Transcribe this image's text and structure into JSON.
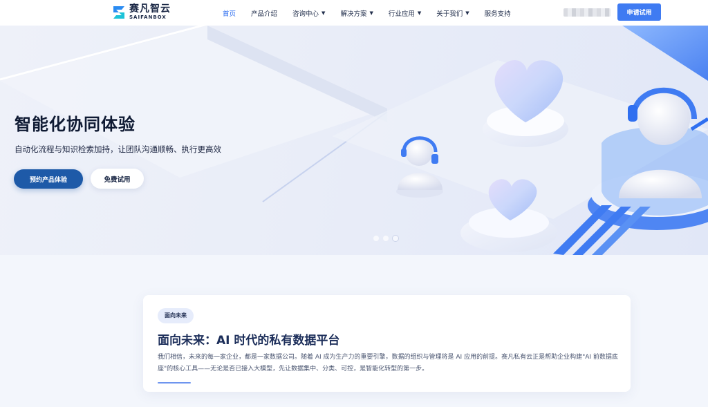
{
  "brand": {
    "name_cn": "赛凡智云",
    "name_en": "SAIFANBOX",
    "accent": "#3f7bf2"
  },
  "nav": {
    "items": [
      {
        "label": "首页",
        "active": true,
        "dropdown": false
      },
      {
        "label": "产品介绍",
        "active": false,
        "dropdown": false
      },
      {
        "label": "咨询中心",
        "active": false,
        "dropdown": true
      },
      {
        "label": "解决方案",
        "active": false,
        "dropdown": true
      },
      {
        "label": "行业应用",
        "active": false,
        "dropdown": true
      },
      {
        "label": "关于我们",
        "active": false,
        "dropdown": true
      },
      {
        "label": "服务支持",
        "active": false,
        "dropdown": false
      }
    ],
    "caret_glyph": "▼",
    "apply_label": "申请试用"
  },
  "hero": {
    "title": "智能化协同体验",
    "subtitle": "自动化流程与知识检索加持，让团队沟通顺畅、执行更高效",
    "primary_label": "预约产品体验",
    "secondary_label": "免费试用",
    "slides": 3,
    "active_slide": 3
  },
  "intro": {
    "badge": "面向未来",
    "title": "面向未来：AI 时代的私有数据平台",
    "text": "我们相信，未来的每一家企业，都是一家数据公司。随着 AI 成为生产力的重要引擎，数据的组织与管理将是 AI 应用的前提。赛凡私有云正是帮助企业构建\"AI 前数据底座\"的核心工具——无论是否已接入大模型，先让数据集中、分类、可控，是智能化转型的第一步。"
  },
  "icons": {
    "logo": "logo-s-icon",
    "dropdown": "chevron-down-icon"
  }
}
